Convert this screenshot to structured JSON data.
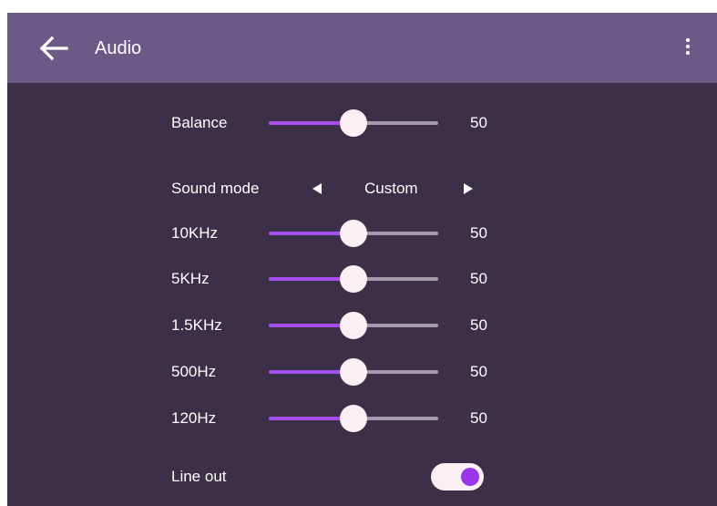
{
  "app": {
    "title": "Audio"
  },
  "icons": {
    "back": "back-arrow-icon",
    "more": "more-vertical-icon"
  },
  "colors": {
    "accent": "#a84df0",
    "header": "#6b5a85",
    "background": "#3c2f48"
  },
  "balance": {
    "label": "Balance",
    "value": "50",
    "level": 0.5
  },
  "sound_mode": {
    "label": "Sound mode",
    "value": "Custom"
  },
  "eq": [
    {
      "label": "10KHz",
      "value": "50",
      "level": 0.5
    },
    {
      "label": "5KHz",
      "value": "50",
      "level": 0.5
    },
    {
      "label": "1.5KHz",
      "value": "50",
      "level": 0.5
    },
    {
      "label": "500Hz",
      "value": "50",
      "level": 0.5
    },
    {
      "label": "120Hz",
      "value": "50",
      "level": 0.5
    }
  ],
  "line_out": {
    "label": "Line out",
    "on": true
  }
}
